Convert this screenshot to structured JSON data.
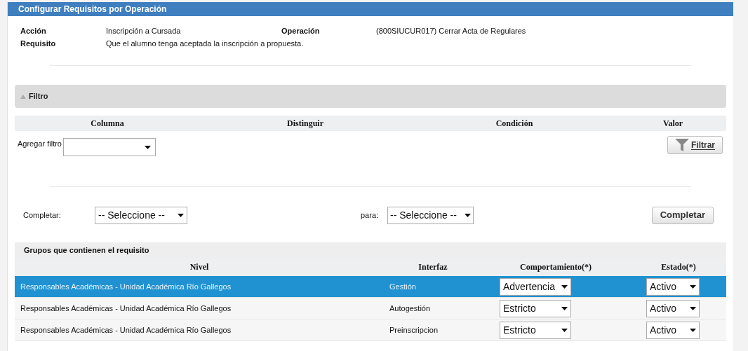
{
  "window": {
    "title": "Configurar Requisitos por Operación"
  },
  "info": {
    "accion_label": "Acción",
    "accion": "Inscripción a Cursada",
    "operacion_label": "Operación",
    "operacion": "(800SIUCUR017) Cerrar Acta de Regulares",
    "requisito_label": "Requisito",
    "requisito": "Que el alumno tenga aceptada la inscripción a propuesta."
  },
  "filter": {
    "title": "Filtro",
    "expanded": true,
    "columns": [
      "Columna",
      "Distinguir",
      "Condición",
      "Valor"
    ],
    "add_label": "Agregar filtro",
    "button": "Filtrar"
  },
  "complete": {
    "label": "Completar:",
    "select": "-- Seleccione --",
    "para_label": "para:",
    "para_select": "-- Seleccione --",
    "button": "Completar"
  },
  "table": {
    "title": "Grupos que contienen el requisito",
    "columns": [
      "Nivel",
      "Interfaz",
      "Comportamiento(*)",
      "Estado(*)"
    ],
    "rows": [
      {
        "nivel": "Responsables Académicas - Unidad Académica Río Gallegos",
        "interfaz": "Gestión",
        "comportamiento": "Advertencia",
        "estado": "Activo",
        "selected": true
      },
      {
        "nivel": "Responsables Académicas - Unidad Académica Río Gallegos",
        "interfaz": "Autogestión",
        "comportamiento": "Estricto",
        "estado": "Activo",
        "selected": false
      },
      {
        "nivel": "Responsables Académicas - Unidad Académica Río Gallegos",
        "interfaz": "Preinscripcion",
        "comportamiento": "Estricto",
        "estado": "Activo",
        "selected": false
      }
    ]
  }
}
